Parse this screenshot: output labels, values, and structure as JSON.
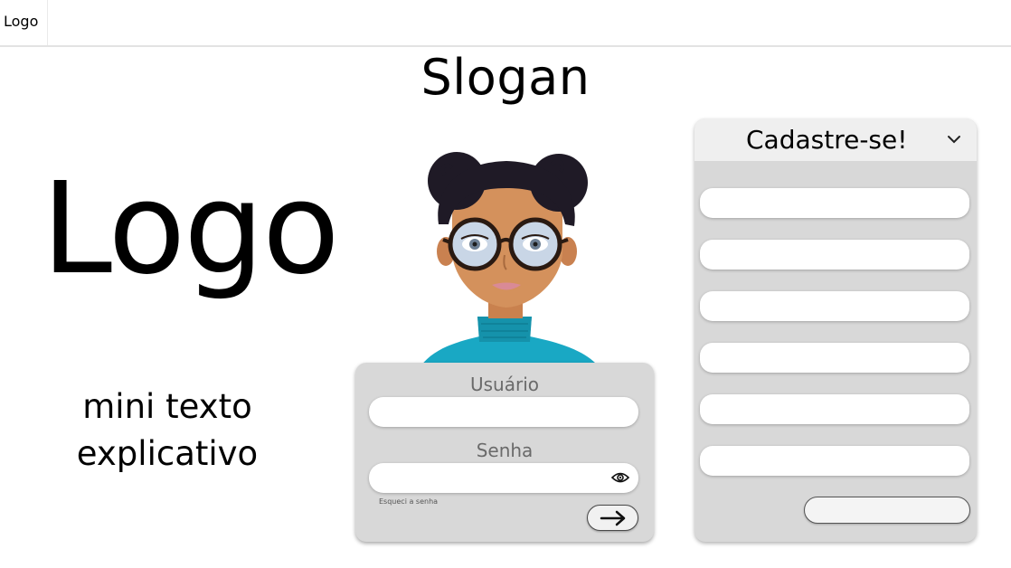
{
  "topbar": {
    "logo": "Logo"
  },
  "hero": {
    "slogan": "Slogan",
    "logo": "Logo",
    "mini_text_line1": "mini texto",
    "mini_text_line2": "explicativo"
  },
  "avatar": {
    "icon": "avatar-illustration"
  },
  "login": {
    "user_label": "Usuário",
    "user_value": "",
    "password_label": "Senha",
    "password_value": "",
    "forgot_label": "Esqueci a senha",
    "toggle_icon": "eye-icon",
    "submit_icon": "arrow-right-icon"
  },
  "register": {
    "title": "Cadastre-se!",
    "dropdown_icon": "chevron-down-icon",
    "fields": [
      "",
      "",
      "",
      "",
      "",
      ""
    ],
    "submit_label": ""
  },
  "colors": {
    "panel": "#d8d8d8",
    "panel_header": "#efefef",
    "label_gray": "#6a6a6a",
    "sweater": "#19a8c4"
  }
}
